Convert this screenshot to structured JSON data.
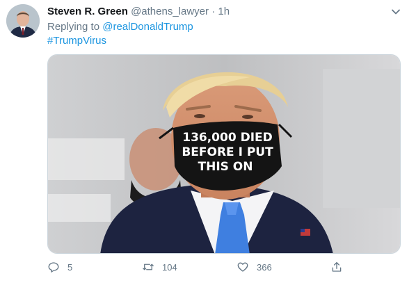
{
  "tweet": {
    "author_name": "Steven R. Green",
    "author_handle": "@athens_lawyer",
    "separator": "·",
    "timestamp": "1h",
    "replying_prefix": "Replying to",
    "replying_to": "@realDonaldTrump",
    "hashtag": "#TrumpVirus",
    "image": {
      "mask_text": [
        "136,000 DIED",
        "BEFORE I PUT",
        "THIS ON"
      ]
    },
    "actions": {
      "reply_count": "5",
      "retweet_count": "104",
      "like_count": "366"
    }
  },
  "colors": {
    "link": "#1b95e0",
    "muted": "#657786",
    "text": "#14171a"
  },
  "icons": [
    "caret-down-icon",
    "reply-icon",
    "retweet-icon",
    "like-icon",
    "share-icon"
  ]
}
